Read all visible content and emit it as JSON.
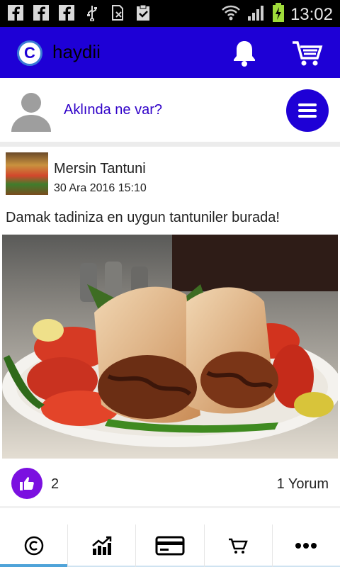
{
  "status_bar": {
    "time": "13:02",
    "left_icons": [
      "facebook-icon",
      "facebook-icon",
      "facebook-icon",
      "usb-icon",
      "no-sim-icon",
      "clipboard-check-icon"
    ],
    "right_icons": [
      "wifi-icon",
      "signal-icon",
      "battery-charging-icon"
    ]
  },
  "app_bar": {
    "title": "haydii",
    "logo_letter": "C",
    "color": "#1e00d6"
  },
  "composer": {
    "placeholder": "Aklında ne var?"
  },
  "post": {
    "author": "Mersin Tantuni",
    "date": "30 Ara 2016 15:10",
    "text": "Damak tadiniza en uygun tantuniler burada!",
    "likes": "2",
    "comments": "1 Yorum"
  },
  "bottom_nav": {
    "tabs": [
      {
        "icon": "copyright-icon",
        "active": true
      },
      {
        "icon": "trending-up-chart-icon",
        "active": false
      },
      {
        "icon": "credit-card-icon",
        "active": false
      },
      {
        "icon": "cart-icon",
        "active": false
      },
      {
        "icon": "more-dots-icon",
        "active": false
      }
    ],
    "accent": "#4fa3d9"
  }
}
